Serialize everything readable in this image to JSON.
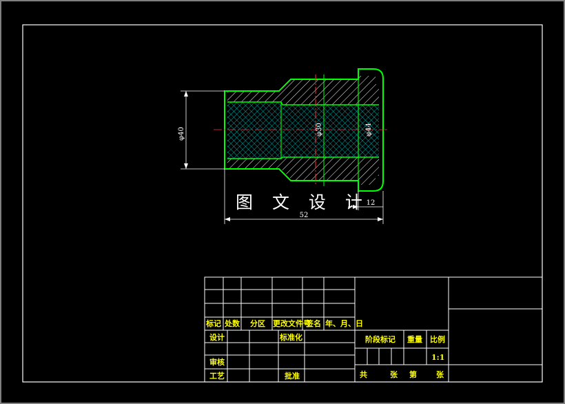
{
  "drawing": {
    "watermark": "图 文 设 计",
    "dimensions": {
      "outer_diameter": "φ40",
      "inner_diameter_1": "φ30",
      "inner_diameter_2": "φ44",
      "flange_length": "12",
      "total_length": "52"
    }
  },
  "title_block": {
    "header_labels": {
      "mark": "标记",
      "count": "处数",
      "zone": "分区",
      "change_doc": "更改文件号",
      "signature": "签名",
      "date": "年、月、日"
    },
    "role_labels": {
      "design": "设计",
      "standardize": "标准化",
      "review": "审核",
      "process": "工艺",
      "approve": "批准"
    },
    "info_labels": {
      "stage_mark": "阶段标记",
      "weight": "重量",
      "scale": "比例",
      "scale_value": "1:1",
      "total": "共",
      "sheets": "张",
      "number": "第",
      "sheet_word": "张"
    }
  },
  "colors": {
    "background": "#000000",
    "frame": "#ffffff",
    "outline": "#00ff00",
    "hatch_crosshatch": "#00cccc",
    "hatch_diagonal": "#ffffff",
    "centerline": "#ff0000",
    "dimension": "#ffffff",
    "table_text": "#ffff00"
  }
}
